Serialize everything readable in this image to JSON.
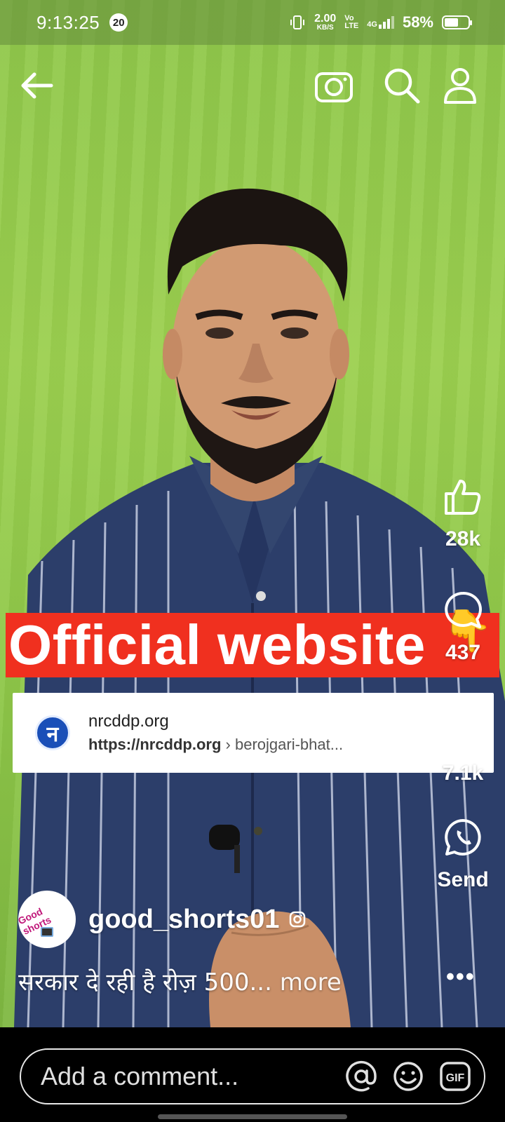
{
  "status_bar": {
    "time": "9:13:25",
    "notification_count": "20",
    "net_speed_value": "2.00",
    "net_speed_unit": "KB/S",
    "volte_top": "Vo",
    "volte_bottom": "LTE",
    "signal_label": "4G",
    "battery": "58%",
    "battery_level": 0.58
  },
  "top_nav": {
    "back_icon": "arrow-left-icon",
    "camera_icon": "camera-icon",
    "search_icon": "search-icon",
    "profile_icon": "person-icon"
  },
  "video_overlay": {
    "banner_text": "Official website",
    "pointing_emoji": "👇",
    "link_card": {
      "logo_letter": "न",
      "domain": "nrcddp.org",
      "url_bold": "https://nrcddp.org",
      "url_rest": " › berojgari-bhat..."
    }
  },
  "actions": {
    "likes": "28k",
    "comments": "437",
    "shares": "7.1k",
    "send_label": "Send"
  },
  "post": {
    "username": "good_shorts01",
    "avatar_text": "Good shorts",
    "caption": "सरकार दे रही है रोज़  500...",
    "more_label": " more"
  },
  "comment": {
    "placeholder": "Add a comment..."
  },
  "colors": {
    "banner_red": "#f0301f",
    "background_green": "#9cd04f",
    "site_logo_blue": "#1a4fb8"
  }
}
